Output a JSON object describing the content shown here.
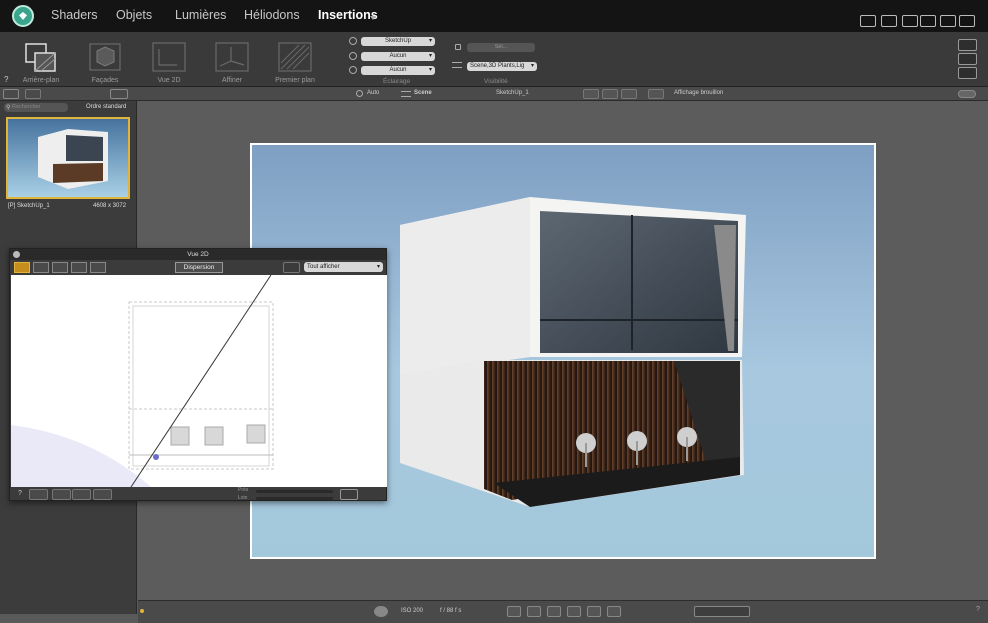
{
  "menu": {
    "items": [
      "Shaders",
      "Objets",
      "Lumières",
      "Héliodons",
      "Insertions"
    ],
    "active": "Insertions"
  },
  "toolbar": {
    "tools": [
      "Arrière-plan",
      "Façades",
      "Vue 2D",
      "Affiner",
      "Premier plan"
    ],
    "eclairage": {
      "label": "Éclairage",
      "sun_value": "SketchUp",
      "light_value": "Aucun",
      "spot_value": "Aucun"
    },
    "visibilite": {
      "label": "Visibilité",
      "field_placeholder": "Sél...",
      "layers_value": "Scene,3D Plants,Lig"
    },
    "help": "?"
  },
  "subbar": {
    "auto_label": "Auto",
    "scene_label": "Scene",
    "camera_name": "SketchUp_1",
    "display_mode": "Affichage brouillon"
  },
  "leftpanel": {
    "search_placeholder": "Rechercher",
    "sort_label": "Ordre standard",
    "thumb_name": "[P] SketchUp_1",
    "thumb_size": "4608 x 3072"
  },
  "vue2d": {
    "title": "Vue 2D",
    "dispersion_label": "Dispersion",
    "view_select": "Tout afficher",
    "slider1_label": "Près",
    "slider2_label": "Loin",
    "help": "?"
  },
  "statusbar": {
    "iso": "ISO 200",
    "aperture": "f / 88 f s",
    "help": "?"
  },
  "colors": {
    "accent": "#e1b43b",
    "logo": "#3aa58c"
  }
}
